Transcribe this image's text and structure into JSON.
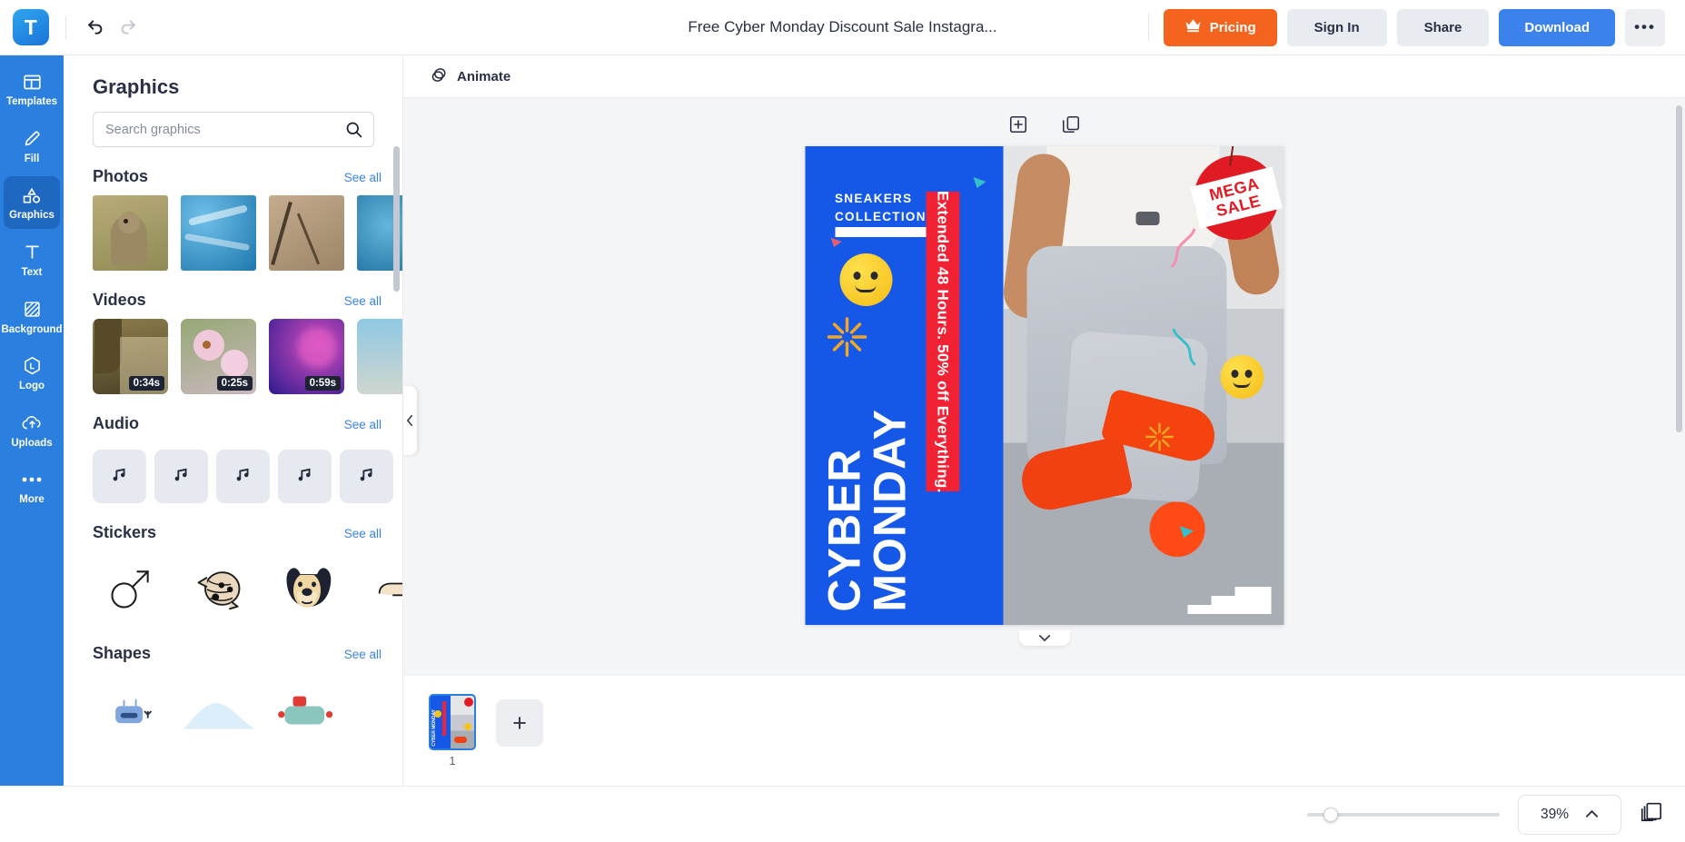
{
  "topbar": {
    "logo_text": "T",
    "doc_title": "Free Cyber Monday Discount Sale Instagra...",
    "pricing_label": "Pricing",
    "signin_label": "Sign In",
    "share_label": "Share",
    "download_label": "Download",
    "more_label": "•••",
    "undo_icon": "undo-icon",
    "redo_icon": "redo-icon",
    "crown_icon": "crown-icon",
    "accent_orange": "#f4641e",
    "accent_blue": "#3b82ec"
  },
  "sidebar": {
    "active": "Graphics",
    "items": [
      {
        "label": "Templates",
        "icon": "templates-icon"
      },
      {
        "label": "Fill",
        "icon": "pencil-icon"
      },
      {
        "label": "Graphics",
        "icon": "shapes-icon"
      },
      {
        "label": "Text",
        "icon": "text-icon"
      },
      {
        "label": "Background",
        "icon": "background-icon"
      },
      {
        "label": "Logo",
        "icon": "hexagon-logo-icon"
      },
      {
        "label": "Uploads",
        "icon": "cloud-upload-icon"
      },
      {
        "label": "More",
        "icon": "ellipsis-icon"
      }
    ]
  },
  "panel": {
    "title": "Graphics",
    "search_placeholder": "Search graphics",
    "search_value": "",
    "see_all_label": "See all",
    "sections": [
      {
        "title": "Photos",
        "items": [
          "prairie-dog-photo",
          "water-photo",
          "cracked-wood-photo",
          "ocean-photo"
        ]
      },
      {
        "title": "Videos",
        "items": [
          "forest-video",
          "blossom-video",
          "ink-smoke-video",
          "sea-video"
        ],
        "durations": [
          "0:34s",
          "0:25s",
          "0:59s",
          ""
        ]
      },
      {
        "title": "Audio",
        "items": [
          "music-note-1",
          "music-note-2",
          "music-note-3",
          "music-note-4",
          "music-note-5"
        ]
      },
      {
        "title": "Stickers",
        "items": [
          "mars-symbol-sticker",
          "mummy-head-sticker",
          "bulldog-face-sticker",
          "hand-sticker"
        ]
      },
      {
        "title": "Shapes",
        "items": [
          "robot-shape",
          "cloud-shape",
          "vehicle-shape"
        ]
      }
    ]
  },
  "toolbar": {
    "animate_label": "Animate",
    "animate_icon": "animate-layers-icon",
    "add_icon": "add-frame-icon",
    "duplicate_icon": "duplicate-icon"
  },
  "design": {
    "sneakers_line1": "SNEAKERS",
    "sneakers_line2": "COLLECTION",
    "red_banner": "Extended 48 Hours. 50% off Everything.",
    "cyber_line1": "CYBER",
    "cyber_line2": "MONDAY",
    "mega_line1": "MEGA",
    "mega_line2": "SALE",
    "bg_blue": "#1558e8",
    "red": "#f02233",
    "mega_red": "#e01b23"
  },
  "pages": {
    "page_number": "1",
    "add_label": "+"
  },
  "bottombar": {
    "zoom_level": "39%",
    "chevron_icon": "chevron-up-icon",
    "page_count": "1",
    "pages_icon": "pages-stack-icon"
  }
}
